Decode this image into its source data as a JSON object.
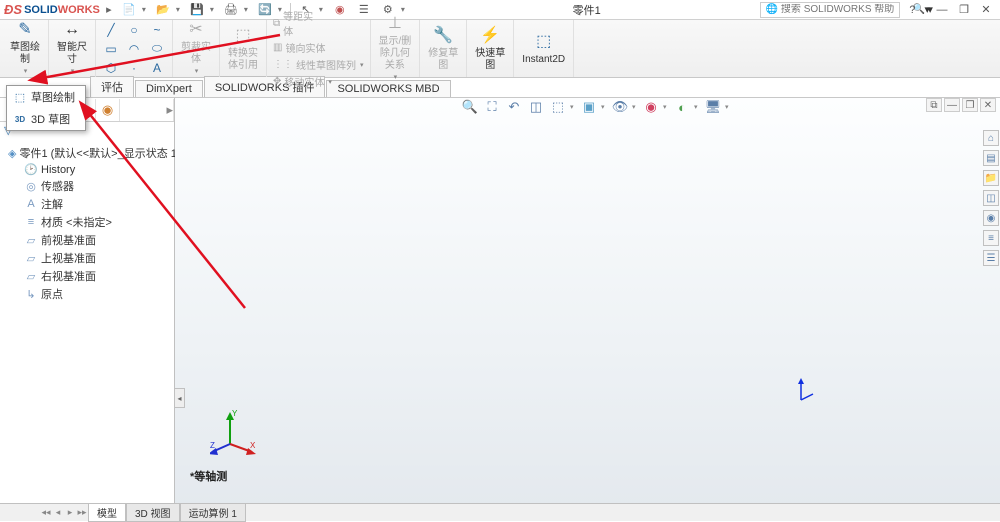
{
  "app": {
    "logo_solid": "SOLID",
    "logo_works": "WORKS"
  },
  "title": "零件1",
  "search": {
    "placeholder": "搜索 SOLIDWORKS 帮助"
  },
  "ribbon": {
    "sketch_btn": "草图绘\n制",
    "smart_dim": "智能尺\n寸",
    "trim": "剪裁实\n体",
    "convert": "转换实\n体引用",
    "offset": "等距实\n体",
    "move": "移动实体",
    "mirror": "镜向实体",
    "linear_pattern": "线性草图阵列",
    "display_del": "显示/删\n除几何\n关系",
    "repair": "修复草\n图",
    "quick": "快速草\n图",
    "instant2d": "Instant2D"
  },
  "sketch_dropdown": {
    "item1": "草图绘制",
    "item2": "3D 草图"
  },
  "tabs": [
    "评估",
    "DimXpert",
    "SOLIDWORKS 插件",
    "SOLIDWORKS MBD"
  ],
  "tree": {
    "root": "零件1  (默认<<默认>_显示状态 1>)",
    "items": [
      "History",
      "传感器",
      "注解",
      "材质 <未指定>",
      "前视基准面",
      "上视基准面",
      "右视基准面",
      "原点"
    ]
  },
  "view_label": "*等轴测",
  "bottom_tabs": [
    "模型",
    "3D 视图",
    "运动算例 1"
  ]
}
